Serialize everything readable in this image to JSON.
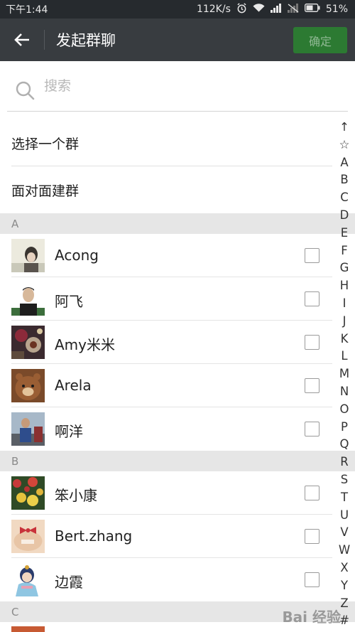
{
  "status_bar": {
    "time": "下午1:44",
    "network_speed": "112K/s",
    "battery": "51%"
  },
  "header": {
    "title": "发起群聊",
    "confirm_label": "确定"
  },
  "search": {
    "placeholder": "搜索"
  },
  "actions": [
    {
      "label": "选择一个群"
    },
    {
      "label": "面对面建群"
    }
  ],
  "sections": [
    {
      "letter": "A",
      "contacts": [
        {
          "name": "Acong"
        },
        {
          "name": "阿飞"
        },
        {
          "name": "Amy米米"
        },
        {
          "name": "Arela"
        },
        {
          "name": "啊洋"
        }
      ]
    },
    {
      "letter": "B",
      "contacts": [
        {
          "name": "笨小康"
        },
        {
          "name": "Bert.zhang"
        },
        {
          "name": "边霞"
        }
      ]
    },
    {
      "letter": "C",
      "contacts": []
    }
  ],
  "index": [
    "↑",
    "☆",
    "A",
    "B",
    "C",
    "D",
    "E",
    "F",
    "G",
    "H",
    "I",
    "J",
    "K",
    "L",
    "M",
    "N",
    "O",
    "P",
    "Q",
    "R",
    "S",
    "T",
    "U",
    "V",
    "W",
    "X",
    "Y",
    "Z",
    "#"
  ],
  "watermark": "Bai 经验",
  "colors": {
    "title_bar": "#383c40",
    "status_bar": "#262a2e",
    "confirm_button": "#2c7a32",
    "section_header": "#e6e6e6"
  }
}
